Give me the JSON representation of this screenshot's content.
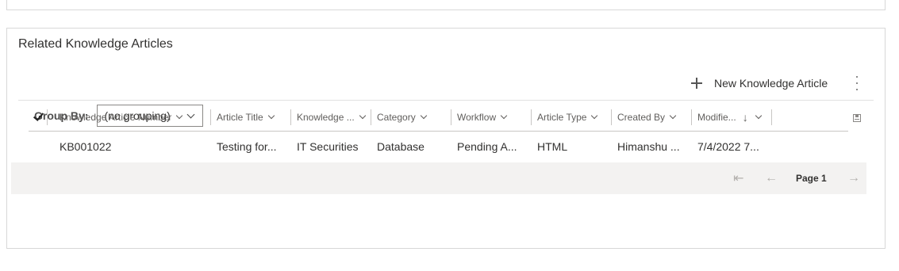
{
  "section": {
    "title": "Related Knowledge Articles"
  },
  "command_bar": {
    "new_label": "New Knowledge Article"
  },
  "group_by": {
    "label": "Group By:",
    "selected": "(no grouping)"
  },
  "grid": {
    "columns": [
      "Knowledge Article Number",
      "Article Title",
      "Knowledge ...",
      "Category",
      "Workflow",
      "Article Type",
      "Created By",
      "Modifie..."
    ],
    "rows": [
      {
        "number": "KB001022",
        "title": "Testing for...",
        "knowledge": "IT Securities",
        "category": "Database",
        "workflow": "Pending A...",
        "type": "HTML",
        "created_by": "Himanshu ...",
        "modified": "7/4/2022 7..."
      }
    ]
  },
  "pagination": {
    "page_label": "Page 1"
  },
  "icons": [
    "plus-icon",
    "more-icon",
    "chevron-down-icon",
    "checkmark-icon",
    "sort-descending-icon",
    "save-icon",
    "first-page-icon",
    "previous-page-icon",
    "next-page-icon"
  ]
}
